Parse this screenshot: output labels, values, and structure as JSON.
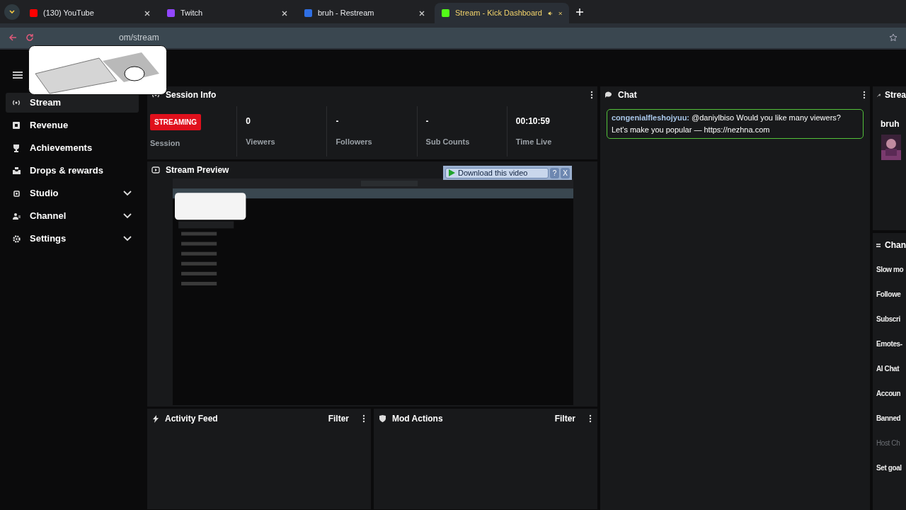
{
  "browser": {
    "tabs": [
      {
        "title": "(130) YouTube",
        "selected": false,
        "audio": false,
        "color": "#ff0000"
      },
      {
        "title": "Twitch",
        "selected": false,
        "audio": false,
        "color": "#9146ff"
      },
      {
        "title": "bruh - Restream",
        "selected": false,
        "audio": false,
        "color": "#2f6fe4"
      },
      {
        "title": "Stream - Kick Dashboard",
        "selected": true,
        "audio": true,
        "color": "#53fc18"
      }
    ],
    "address": "om/stream"
  },
  "sidebar": {
    "items": [
      {
        "label": "Stream",
        "selected": true,
        "expandable": false
      },
      {
        "label": "Revenue",
        "selected": false,
        "expandable": false
      },
      {
        "label": "Achievements",
        "selected": false,
        "expandable": false
      },
      {
        "label": "Drops & rewards",
        "selected": false,
        "expandable": false
      },
      {
        "label": "Studio",
        "selected": false,
        "expandable": true
      },
      {
        "label": "Channel",
        "selected": false,
        "expandable": true
      },
      {
        "label": "Settings",
        "selected": false,
        "expandable": true
      }
    ]
  },
  "session_info": {
    "title": "Session Info",
    "status": "STREAMING",
    "status_label": "Session",
    "stats": [
      {
        "value": "0",
        "label": "Viewers"
      },
      {
        "value": "-",
        "label": "Followers"
      },
      {
        "value": "-",
        "label": "Sub Counts"
      },
      {
        "value": "00:10:59",
        "label": "Time Live"
      }
    ]
  },
  "stream_preview": {
    "title": "Stream Preview"
  },
  "download_bar": {
    "label": "Download this video",
    "help": "?",
    "close": "X"
  },
  "activity_feed": {
    "title": "Activity Feed",
    "filter": "Filter"
  },
  "mod_actions": {
    "title": "Mod Actions",
    "filter": "Filter"
  },
  "chat": {
    "title": "Chat",
    "messages": [
      {
        "user": "congenialfleshojyuu:",
        "text": "@daniylbiso Would you like many viewers? Let's make you popular — https://nezhna.com"
      }
    ]
  },
  "stream_panel": {
    "title": "Strea",
    "name": "bruh"
  },
  "chat_settings": {
    "title": "Chan",
    "items": [
      {
        "label": "Slow mo",
        "disabled": false
      },
      {
        "label": "Followe",
        "disabled": false
      },
      {
        "label": "Subscri",
        "disabled": false
      },
      {
        "label": "Emotes-",
        "disabled": false
      },
      {
        "label": "AI Chat",
        "disabled": false
      },
      {
        "label": "Accoun",
        "disabled": false
      },
      {
        "label": "Banned",
        "disabled": false
      },
      {
        "label": "Host Ch",
        "disabled": true
      },
      {
        "label": "Set goal",
        "disabled": false
      }
    ]
  }
}
